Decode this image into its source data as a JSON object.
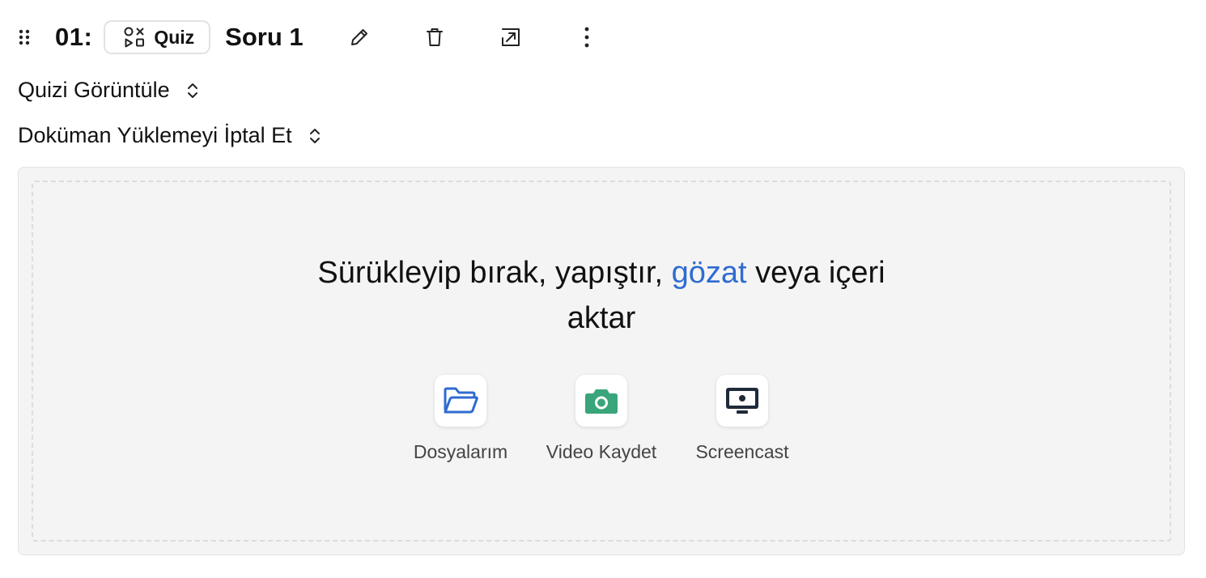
{
  "header": {
    "index": "01:",
    "type_label": "Quiz",
    "title": "Soru 1",
    "icons": {
      "drag": "drag-handle-icon",
      "quiz": "quiz-shapes-icon",
      "edit": "pencil-icon",
      "delete": "trash-icon",
      "open": "open-external-icon",
      "more": "more-vertical-icon"
    }
  },
  "settings": [
    {
      "label": "Quizi Görüntüle",
      "icon": "chevron-up-down-icon"
    },
    {
      "label": "Doküman Yüklemeyi İptal Et",
      "icon": "chevron-up-down-icon"
    }
  ],
  "upload": {
    "text_before": "Sürükleyip bırak, yapıştır, ",
    "browse_link": "gözat",
    "text_after": " veya içeri",
    "text_line2": "aktar",
    "sources": [
      {
        "label": "Dosyalarım",
        "icon": "folder-icon",
        "color": "#2f6bd1"
      },
      {
        "label": "Video Kaydet",
        "icon": "camera-icon",
        "color": "#3aa57a"
      },
      {
        "label": "Screencast",
        "icon": "screencast-icon",
        "color": "#1f2a3a"
      }
    ]
  },
  "colors": {
    "link": "#2f6bd1",
    "card_bg": "#f4f4f4"
  }
}
